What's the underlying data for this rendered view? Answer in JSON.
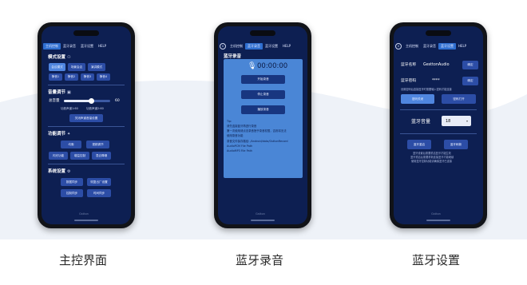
{
  "phones": [
    {
      "caption": "主控界面",
      "tabs": [
        "主机控制",
        "蓝牙录音",
        "蓝牙设置",
        "HELP"
      ],
      "active_tab": 0,
      "mode_settings": {
        "title": "模式设置",
        "icon": "mode-settings-icon",
        "buttons": [
          "会议模式",
          "场景会议",
          "演讲模式",
          "静音1",
          "静音2",
          "静音3",
          "静音4"
        ]
      },
      "volume": {
        "title": "音量调节",
        "icon": "speaker-icon",
        "total_label": "总音量",
        "total_value": "60",
        "slider_fraction": 0.6,
        "mic_label1": "功放声道1:60",
        "mic_label2": "功放声道2:60",
        "reset_button": "关闭声道音量设置"
      },
      "function": {
        "title": "功能调节",
        "icon": "function-icon",
        "buttons": [
          "均衡",
          "视频调节",
          "闪光功能",
          "增益控制",
          "混合降噪"
        ]
      },
      "system": {
        "title": "系统设置",
        "icon": "gear-icon",
        "buttons": [
          "数据同步",
          "恢复出厂设置",
          "控制同步",
          "时间同步"
        ]
      },
      "brand": "Gstton"
    },
    {
      "caption": "蓝牙录音",
      "tabs": [
        "主机控制",
        "蓝牙录音",
        "蓝牙设置",
        "HELP"
      ],
      "active_tab": 1,
      "title": "蓝牙录音",
      "timer": "00:00:00",
      "buttons": [
        "开始录音",
        "停止录音",
        "播放录音"
      ],
      "tips": [
        "Tip:",
        "请先连接蓝牙再进行录音",
        "第一次使用请点击录音授予录音权限，否则将无法",
        "使用录音功能",
        "录音文件保存路径: /Android/data/GsttonRecord",
        "AudioPCM File Path",
        "AudioMP3 File Path"
      ],
      "brand": "Gstton"
    },
    {
      "caption": "蓝牙设置",
      "tabs": [
        "主机控制",
        "蓝牙录音",
        "蓝牙设置",
        "HELP"
      ],
      "active_tab": 2,
      "name_label": "蓝牙名称",
      "name_value": "GesttonAudio",
      "name_confirm": "确定",
      "pwd_label": "蓝牙密码",
      "pwd_value": "****",
      "pwd_confirm": "确定",
      "pwd_note": "设置密码后连接蓝牙时需要输入密码才能连接",
      "pwd_off": "密码关闭",
      "pwd_on": "密码打开",
      "vol_label": "蓝牙音量",
      "vol_value": "18",
      "vol_caret": "▾",
      "restore_button": "蓝牙重启",
      "refresh_button": "蓝牙刷新",
      "notes": [
        "蓝牙设置后需要重启蓝牙才能生效",
        "蓝牙重启后需要重新连接蓝牙才能继续",
        "使用蓝牙控制功能请确保蓝牙已连接"
      ],
      "brand": "Gstton"
    }
  ]
}
